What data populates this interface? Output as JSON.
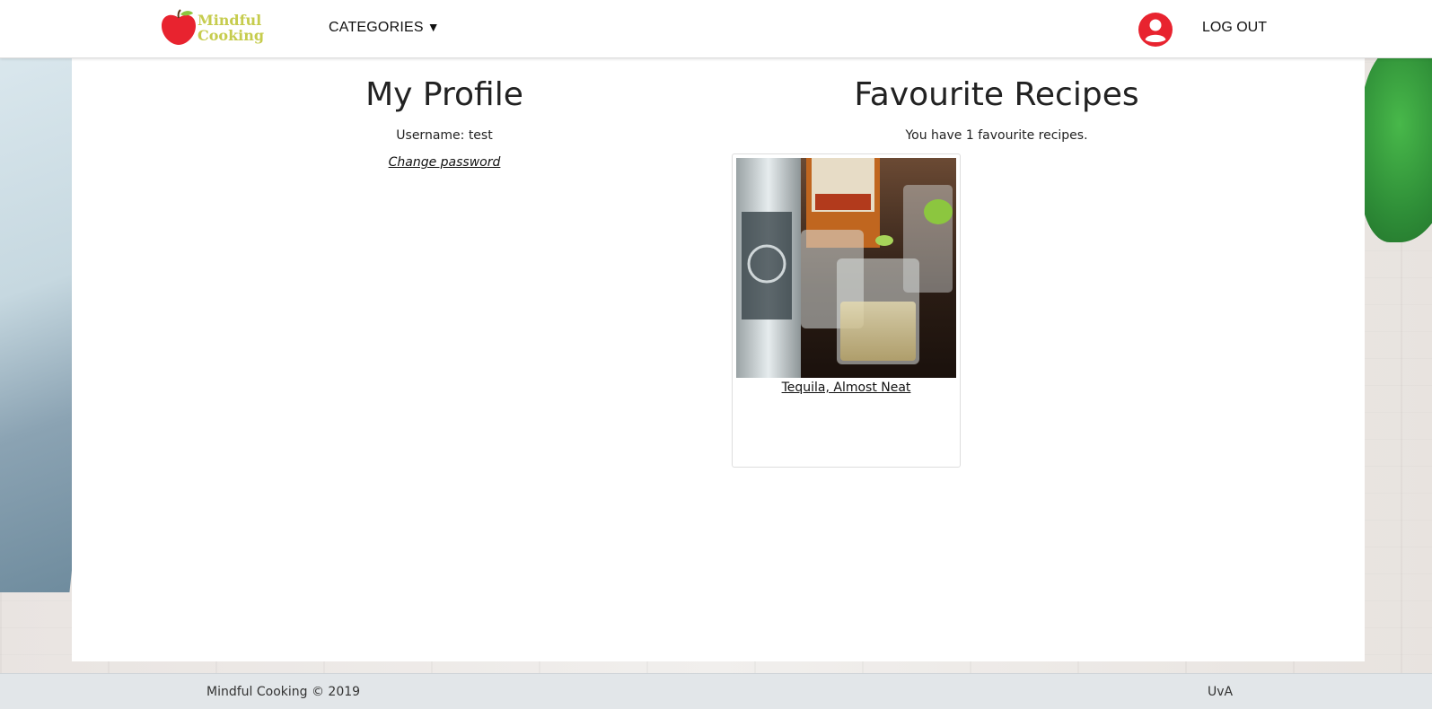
{
  "header": {
    "logo_line1": "Mindful",
    "logo_line2": "Cooking",
    "categories_label": "CATEGORIES",
    "logout_label": "LOG OUT"
  },
  "profile": {
    "title": "My Profile",
    "username": "Username: test",
    "change_password": "Change password"
  },
  "favourites": {
    "title": "Favourite Recipes",
    "count_text": "You have 1 favourite recipes.",
    "recipes": [
      {
        "title": "Tequila, Almost Neat"
      }
    ]
  },
  "footer": {
    "left_text": "Mindful Cooking © 2019",
    "right_text": "UvA"
  },
  "colors": {
    "brand_red": "#e8232f",
    "logo_green": "#c6cc4d",
    "footer_bg": "#e2e6e9"
  },
  "icons": {
    "logo": "apple-icon",
    "account": "user-circle-icon",
    "dropdown": "caret-down-icon"
  }
}
